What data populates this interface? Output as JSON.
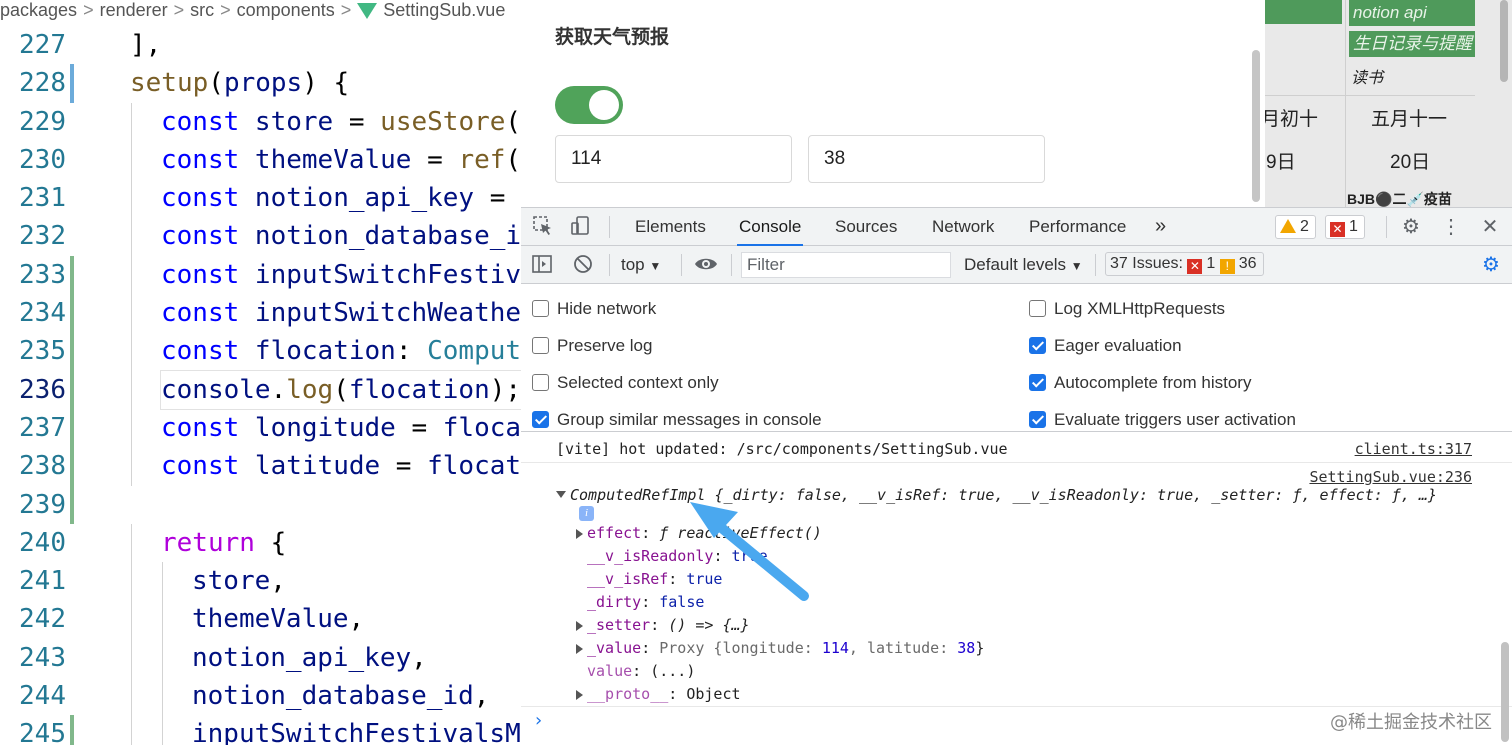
{
  "editor": {
    "breadcrumb": [
      "packages",
      "renderer",
      "src",
      "components",
      "SettingSub.vue"
    ],
    "lines": [
      {
        "n": "227",
        "gutter": "",
        "indent": 1,
        "tokens": [
          [
            "punc",
            "],"
          ]
        ]
      },
      {
        "n": "228",
        "gutter": "mod",
        "indent": 1,
        "tokens": [
          [
            "fn",
            "setup"
          ],
          [
            "punc",
            "("
          ],
          [
            "var",
            "props"
          ],
          [
            "punc",
            ") {"
          ]
        ]
      },
      {
        "n": "229",
        "gutter": "",
        "indent": 2,
        "tokens": [
          [
            "kw",
            "const "
          ],
          [
            "var",
            "store"
          ],
          [
            "punc",
            " = "
          ],
          [
            "fn",
            "useStore"
          ],
          [
            "punc",
            "()"
          ]
        ]
      },
      {
        "n": "230",
        "gutter": "",
        "indent": 2,
        "tokens": [
          [
            "kw",
            "const "
          ],
          [
            "var",
            "themeValue"
          ],
          [
            "punc",
            " = "
          ],
          [
            "fn",
            "ref"
          ],
          [
            "punc",
            "(s"
          ]
        ]
      },
      {
        "n": "231",
        "gutter": "",
        "indent": 2,
        "tokens": [
          [
            "kw",
            "const "
          ],
          [
            "var",
            "notion_api_key"
          ],
          [
            "punc",
            " = r"
          ]
        ]
      },
      {
        "n": "232",
        "gutter": "",
        "indent": 2,
        "tokens": [
          [
            "kw",
            "const "
          ],
          [
            "var",
            "notion_database_id"
          ]
        ]
      },
      {
        "n": "233",
        "gutter": "add",
        "indent": 2,
        "tokens": [
          [
            "kw",
            "const "
          ],
          [
            "var",
            "inputSwitchFestiva"
          ]
        ]
      },
      {
        "n": "234",
        "gutter": "add",
        "indent": 2,
        "tokens": [
          [
            "kw",
            "const "
          ],
          [
            "var",
            "inputSwitchWeather"
          ]
        ]
      },
      {
        "n": "235",
        "gutter": "add",
        "indent": 2,
        "tokens": [
          [
            "kw",
            "const "
          ],
          [
            "var",
            "flocation"
          ],
          [
            "punc",
            ": "
          ],
          [
            "type",
            "Compute"
          ]
        ]
      },
      {
        "n": "236",
        "gutter": "add",
        "indent": 2,
        "current": true,
        "tokens": [
          [
            "var",
            "console"
          ],
          [
            "punc",
            "."
          ],
          [
            "fn",
            "log"
          ],
          [
            "punc",
            "("
          ],
          [
            "var",
            "flocation"
          ],
          [
            "punc",
            ");"
          ]
        ]
      },
      {
        "n": "237",
        "gutter": "add",
        "indent": 2,
        "tokens": [
          [
            "kw",
            "const "
          ],
          [
            "var",
            "longitude"
          ],
          [
            "punc",
            " = "
          ],
          [
            "var",
            "flocat"
          ]
        ]
      },
      {
        "n": "238",
        "gutter": "add",
        "indent": 2,
        "tokens": [
          [
            "kw",
            "const "
          ],
          [
            "var",
            "latitude"
          ],
          [
            "punc",
            " = "
          ],
          [
            "var",
            "flocati"
          ]
        ]
      },
      {
        "n": "239",
        "gutter": "add",
        "indent": 0,
        "tokens": []
      },
      {
        "n": "240",
        "gutter": "",
        "indent": 2,
        "tokens": [
          [
            "ctrl",
            "return"
          ],
          [
            "punc",
            " {"
          ]
        ]
      },
      {
        "n": "241",
        "gutter": "",
        "indent": 3,
        "tokens": [
          [
            "var",
            "store"
          ],
          [
            "punc",
            ","
          ]
        ]
      },
      {
        "n": "242",
        "gutter": "",
        "indent": 3,
        "tokens": [
          [
            "var",
            "themeValue"
          ],
          [
            "punc",
            ","
          ]
        ]
      },
      {
        "n": "243",
        "gutter": "",
        "indent": 3,
        "tokens": [
          [
            "var",
            "notion_api_key"
          ],
          [
            "punc",
            ","
          ]
        ]
      },
      {
        "n": "244",
        "gutter": "",
        "indent": 3,
        "tokens": [
          [
            "var",
            "notion_database_id"
          ],
          [
            "punc",
            ","
          ]
        ]
      },
      {
        "n": "245",
        "gutter": "add",
        "indent": 3,
        "tokens": [
          [
            "var",
            "inputSwitchFestivalsMo"
          ]
        ]
      }
    ]
  },
  "preview": {
    "weather_title": "获取天气预报",
    "toggle_on": true,
    "longitude_value": "114",
    "latitude_value": "38",
    "calendar": {
      "tag_notion": "notion api",
      "tag_birthday": "生日记录与提醒",
      "read": "读书",
      "lunar_left": "月初十",
      "lunar_right": "五月十一",
      "day_left": "9日",
      "day_right": "20日",
      "note": "BJB⚫二💉疫苗"
    }
  },
  "devtools": {
    "tabs": [
      "Elements",
      "Console",
      "Sources",
      "Network",
      "Performance"
    ],
    "active_tab": "Console",
    "more_tabs": "»",
    "warnings": "2",
    "errors": "1",
    "context": "top",
    "filter_placeholder": "Filter",
    "levels": "Default levels",
    "issues_label": "37 Issues:",
    "issues_errors": "1",
    "issues_info": "36",
    "settings_left": [
      {
        "label": "Hide network",
        "checked": false
      },
      {
        "label": "Preserve log",
        "checked": false
      },
      {
        "label": "Selected context only",
        "checked": false
      },
      {
        "label": "Group similar messages in console",
        "checked": true
      }
    ],
    "settings_right": [
      {
        "label": "Log XMLHttpRequests",
        "checked": false
      },
      {
        "label": "Eager evaluation",
        "checked": true
      },
      {
        "label": "Autocomplete from history",
        "checked": true
      },
      {
        "label": "Evaluate triggers user activation",
        "checked": true
      }
    ],
    "console": {
      "msg1": "[vite] hot updated: /src/components/SettingSub.vue",
      "msg1_src": "client.ts:317",
      "msg2_src": "SettingSub.vue:236",
      "obj_head": "ComputedRefImpl",
      "obj_preview": "{_dirty: false, __v_isRef: true, __v_isReadonly: true, _setter: ƒ, effect: ƒ, …}",
      "info_icon": "i",
      "props": {
        "effect_key": "effect",
        "effect_val": "ƒ reactiveEffect()",
        "readonly_key": "__v_isReadonly",
        "readonly_val": "true",
        "isref_key": "__v_isRef",
        "isref_val": "true",
        "dirty_key": "_dirty",
        "dirty_val": "false",
        "setter_key": "_setter",
        "setter_val": "() => {…}",
        "value_key": "_value",
        "value_val_prefix": "Proxy {longitude: ",
        "value_lon": "114",
        "value_mid": ", latitude: ",
        "value_lat": "38",
        "value_suffix": "}",
        "getter_key": "value",
        "getter_val": "(...)",
        "proto_key": "__proto__",
        "proto_val": "Object"
      },
      "prompt": "›"
    },
    "watermark": "@稀土掘金技术社区"
  },
  "colors": {
    "accent": "#1a73e8",
    "toggle": "#50a35a",
    "arrow": "#4aa8ef"
  }
}
